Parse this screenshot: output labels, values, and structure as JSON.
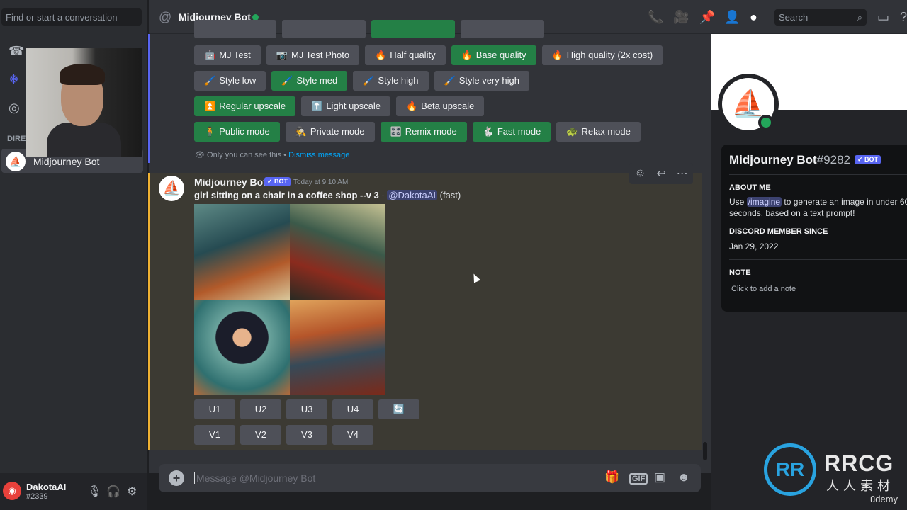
{
  "sidebar": {
    "search_placeholder": "Find or start a conversation",
    "direct_label": "DIREC",
    "dm": {
      "name": "Midjourney Bot"
    },
    "user": {
      "name": "DakotaAI",
      "tag": "#2339"
    }
  },
  "header": {
    "title": "Midjourney Bot",
    "search_placeholder": "Search"
  },
  "system_message": {
    "rows": [
      [
        {
          "emoji": "🤖",
          "label": "MJ Test",
          "active": false
        },
        {
          "emoji": "📷",
          "label": "MJ Test Photo",
          "active": false
        },
        {
          "emoji": "🔥",
          "label": "Half quality",
          "active": false
        },
        {
          "emoji": "🔥",
          "label": "Base quality",
          "active": true
        },
        {
          "emoji": "🔥",
          "label": "High quality (2x cost)",
          "active": false
        }
      ],
      [
        {
          "emoji": "🖌️",
          "label": "Style low",
          "active": false
        },
        {
          "emoji": "🖌️",
          "label": "Style med",
          "active": true
        },
        {
          "emoji": "🖌️",
          "label": "Style high",
          "active": false
        },
        {
          "emoji": "🖌️",
          "label": "Style very high",
          "active": false
        }
      ],
      [
        {
          "emoji": "⏫",
          "label": "Regular upscale",
          "active": true
        },
        {
          "emoji": "⬆️",
          "label": "Light upscale",
          "active": false
        },
        {
          "emoji": "🔥",
          "label": "Beta upscale",
          "active": false
        }
      ],
      [
        {
          "emoji": "🧍",
          "label": "Public mode",
          "active": true
        },
        {
          "emoji": "🕵️",
          "label": "Private mode",
          "active": false
        },
        {
          "emoji": "🎛️",
          "label": "Remix mode",
          "active": true
        },
        {
          "emoji": "🐇",
          "label": "Fast mode",
          "active": true
        },
        {
          "emoji": "🐢",
          "label": "Relax mode",
          "active": false
        }
      ]
    ],
    "ephemeral_note": "Only you can see this •",
    "dismiss": "Dismiss message"
  },
  "message": {
    "author": "Midjourney Bot",
    "badge": "✓ BOT",
    "timestamp": "Today at 9:10 AM",
    "prompt": "girl sitting on a chair in a coffee shop --v 3",
    "separator": " - ",
    "mention": "@DakotaAI",
    "mode": "(fast)",
    "upscale_buttons": [
      "U1",
      "U2",
      "U3",
      "U4"
    ],
    "variation_buttons": [
      "V1",
      "V2",
      "V3",
      "V4"
    ],
    "reroll_icon": "🔄"
  },
  "composer": {
    "placeholder": "Message @Midjourney Bot"
  },
  "profile": {
    "name": "Midjourney Bot",
    "discriminator": "#9282",
    "badge": "✓ BOT",
    "about_heading": "ABOUT ME",
    "about_pre": "Use ",
    "about_cmd": "/imagine",
    "about_post": " to generate an image in under 60 seconds, based on a text prompt!",
    "member_heading": "DISCORD MEMBER SINCE",
    "member_since": "Jan 29, 2022",
    "note_heading": "NOTE",
    "note_placeholder": "Click to add a note"
  },
  "watermark": {
    "text": "RRCG",
    "sub": "人人素材",
    "udemy": "ūdemy"
  },
  "colors": {
    "accent": "#5865f2",
    "green": "#248046",
    "mention_bar": "#f0b232"
  }
}
